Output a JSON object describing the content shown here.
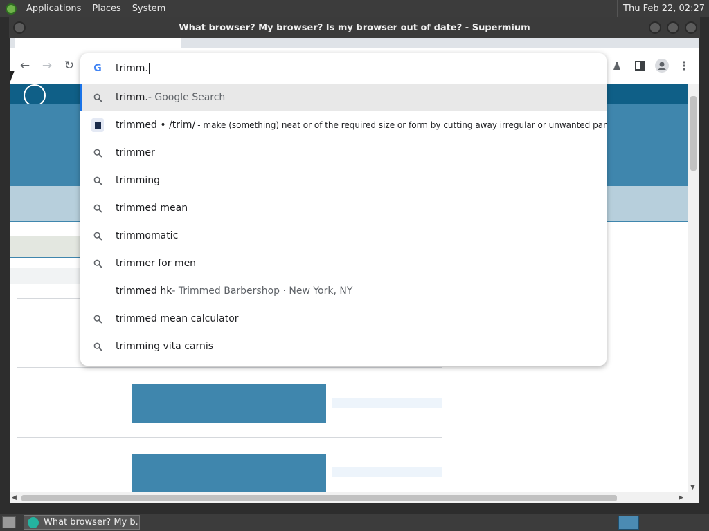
{
  "desktop": {
    "menus": [
      "Applications",
      "Places",
      "System"
    ],
    "clock": "Thu Feb 22, 02:27"
  },
  "window": {
    "title": "What browser? My browser? Is my browser out of date? - Supermium"
  },
  "omnibox": {
    "query": "trimm.",
    "suggestions": [
      {
        "icon": "search-icon",
        "text": "trimm.",
        "detail": " - Google Search"
      },
      {
        "icon": "dictionary-icon",
        "text": "trimmed • /trim/",
        "detail": " - make (something) neat or of the required size or form by cutting away irregular or unwanted parts."
      },
      {
        "icon": "search-icon",
        "text": "trimmer",
        "detail": ""
      },
      {
        "icon": "search-icon",
        "text": "trimming",
        "detail": ""
      },
      {
        "icon": "search-icon",
        "text": "trimmed mean",
        "detail": ""
      },
      {
        "icon": "search-icon",
        "text": "trimmomatic",
        "detail": ""
      },
      {
        "icon": "search-icon",
        "text": "trimmer for men",
        "detail": ""
      },
      {
        "icon": "none",
        "text": "trimmed hk",
        "detail": " - Trimmed Barbershop · New York, NY"
      },
      {
        "icon": "search-icon",
        "text": "trimmed mean calculator",
        "detail": ""
      },
      {
        "icon": "search-icon",
        "text": "trimming vita carnis",
        "detail": ""
      }
    ]
  },
  "taskbar": {
    "task_label": "What browser? My b..."
  },
  "colors": {
    "brand_dark": "#0f5f87",
    "brand": "#3f86ad",
    "brand_light": "#b7cfdc",
    "highlight": "#1a73e8"
  }
}
